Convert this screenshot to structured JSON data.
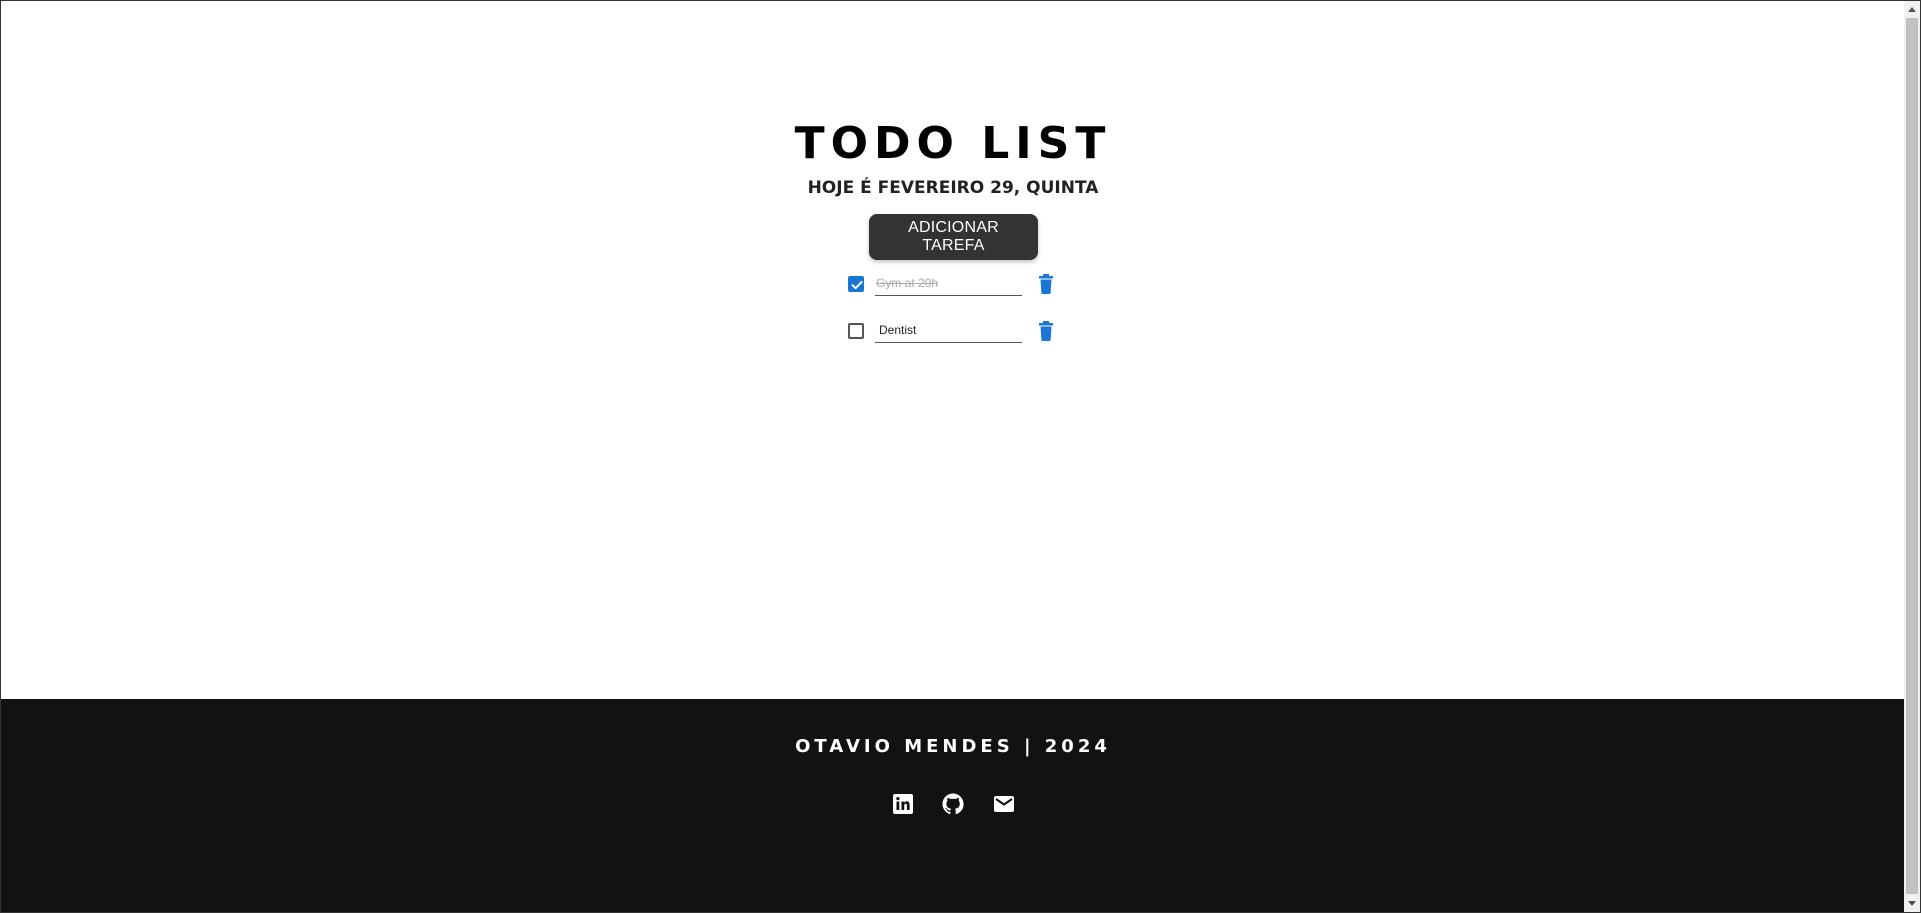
{
  "header": {
    "title": "TODO LIST",
    "subtitle": "HOJE É FEVEREIRO 29, QUINTA"
  },
  "add_button": {
    "label": "ADICIONAR TAREFA"
  },
  "tasks": [
    {
      "text": "Gym at 20h",
      "completed": true
    },
    {
      "text": "Dentist",
      "completed": false
    }
  ],
  "footer": {
    "text": "OTAVIO MENDES | 2024",
    "links": [
      "linkedin-icon",
      "github-icon",
      "mail-icon"
    ]
  },
  "colors": {
    "accent": "#1976d2",
    "button_bg": "#333333",
    "footer_bg": "#121212"
  }
}
